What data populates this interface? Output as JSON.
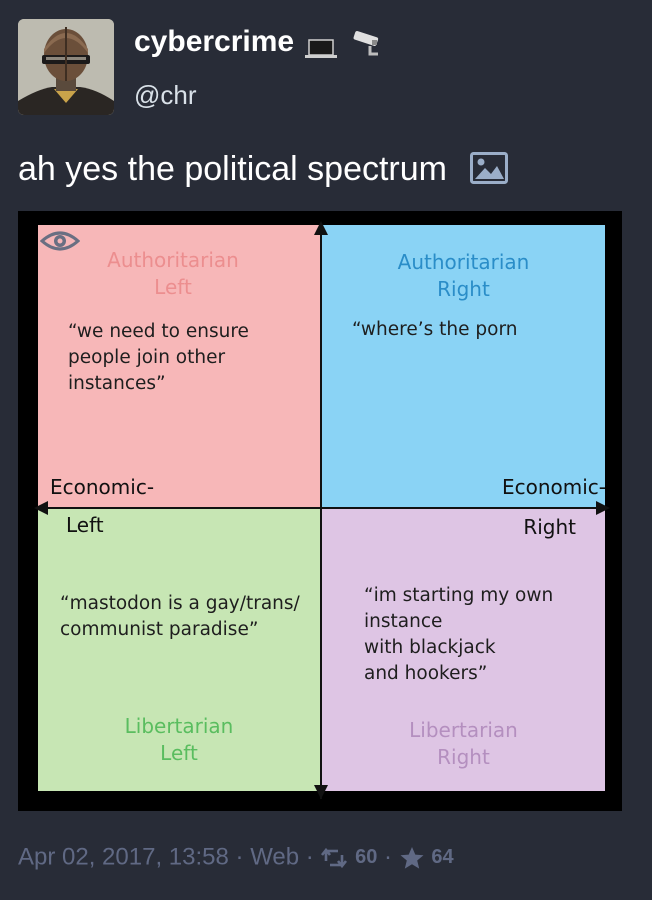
{
  "account": {
    "display_name": "cybercrime",
    "handle": "@chr",
    "emojis": [
      "laptop-icon",
      "surveillance-camera-icon"
    ]
  },
  "status": {
    "text": "ah yes the political spectrum",
    "media_icon": "image-icon"
  },
  "compass": {
    "quadrants": {
      "auth_left": {
        "title": "Authoritarian\nLeft",
        "quote": "“we need to ensure\npeople join other\ninstances”",
        "color": "#f7b7b8"
      },
      "auth_right": {
        "title": "Authoritarian\nRight",
        "quote": "“where’s the porn",
        "color": "#8ad3f5"
      },
      "lib_left": {
        "title": "Libertarian\nLeft",
        "quote": "“mastodon is a gay/trans/\ncommunist paradise”",
        "color": "#c7e6b4"
      },
      "lib_right": {
        "title": "Libertarian\nRight",
        "quote": "“im starting my own\ninstance\nwith blackjack\nand hookers”",
        "color": "#dec5e4"
      }
    },
    "axis_left_top": "Economic-",
    "axis_left_bottom": "Left",
    "axis_right_top": "Economic-",
    "axis_right_bottom": "Right"
  },
  "footer": {
    "date": "Apr 02, 2017, 13:58",
    "separator": "·",
    "app": "Web",
    "boosts": "60",
    "favourites": "64"
  }
}
